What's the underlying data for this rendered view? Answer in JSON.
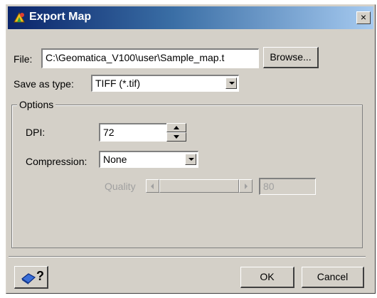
{
  "window": {
    "title": "Export Map",
    "close_glyph": "×",
    "title_icon": "geomatica-app-icon"
  },
  "file": {
    "label": "File:",
    "value": "C:\\Geomatica_V100\\user\\Sample_map.t",
    "browse_label": "Browse..."
  },
  "save_as": {
    "label": "Save as type:",
    "value": "TIFF (*.tif)"
  },
  "options": {
    "legend": "Options",
    "dpi": {
      "label": "DPI:",
      "value": "72"
    },
    "compression": {
      "label": "Compression:",
      "value": "None"
    },
    "quality": {
      "label": "Quality",
      "value": "80",
      "enabled": false
    }
  },
  "footer": {
    "help_glyph": "?",
    "ok_label": "OK",
    "cancel_label": "Cancel"
  }
}
